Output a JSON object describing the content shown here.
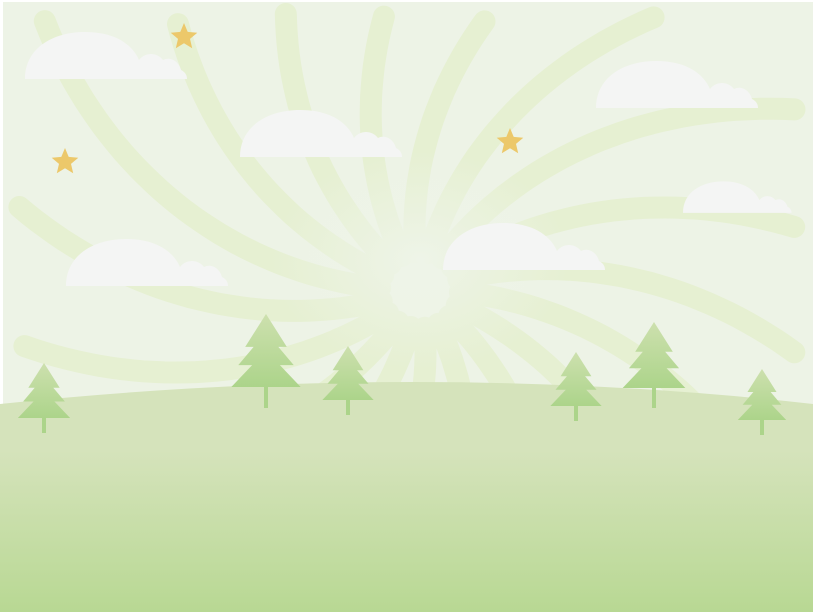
{
  "scene": {
    "colors": {
      "sky": "#edf3e6",
      "swirl": "#e6f0d2",
      "cloud": "#f4f5f4",
      "star": "#ecc86a",
      "hill_top": "#d5e3bb",
      "hill_bottom": "#b8d893",
      "tree_top": "#cde0ae",
      "tree_bottom": "#acd48a"
    },
    "clouds": 6,
    "stars": 3,
    "trees": 6
  }
}
